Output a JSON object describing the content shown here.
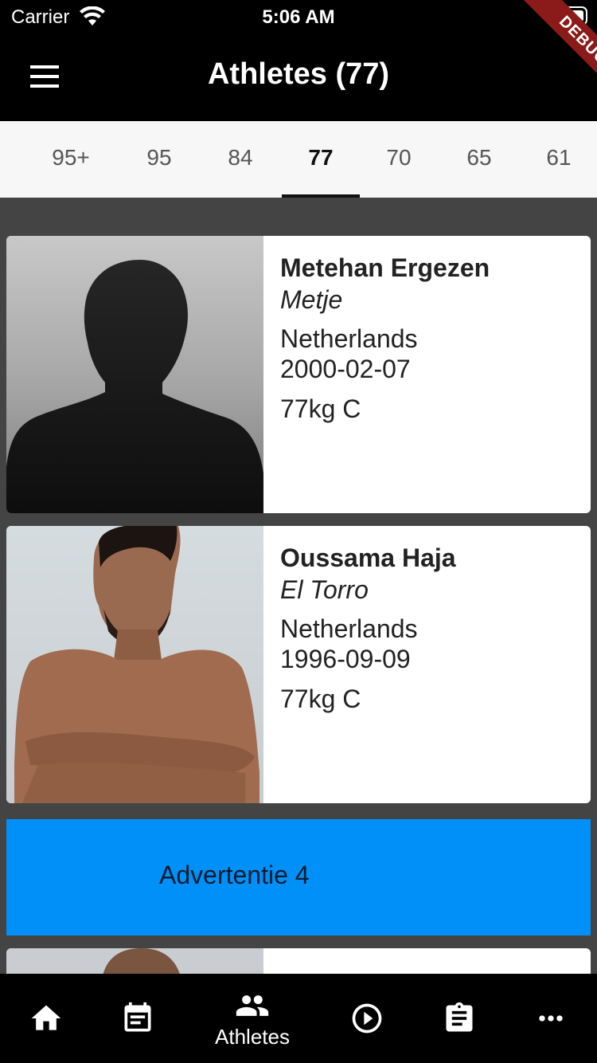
{
  "status_bar": {
    "carrier": "Carrier",
    "time": "5:06 AM"
  },
  "debug_banner": "DEBUG",
  "app_bar": {
    "title": "Athletes (77)"
  },
  "tabs": [
    {
      "label": "95+"
    },
    {
      "label": "95"
    },
    {
      "label": "84"
    },
    {
      "label": "77",
      "active": true
    },
    {
      "label": "70"
    },
    {
      "label": "65"
    },
    {
      "label": "61"
    }
  ],
  "athletes": [
    {
      "name": "Metehan Ergezen",
      "nickname": "Metje",
      "country": "Netherlands",
      "dob": "2000-02-07",
      "weight_class": "77kg  C"
    },
    {
      "name": "Oussama Haja",
      "nickname": "El Torro",
      "country": "Netherlands",
      "dob": "1996-09-09",
      "weight_class": "77kg  C"
    }
  ],
  "ad": {
    "label": "Advertentie 4",
    "color": "#0090f8"
  },
  "bottom_nav": {
    "items": [
      {
        "icon": "home-icon"
      },
      {
        "icon": "calendar-icon"
      },
      {
        "icon": "people-icon",
        "label": "Athletes",
        "active": true
      },
      {
        "icon": "play-circle-icon"
      },
      {
        "icon": "clipboard-icon"
      },
      {
        "icon": "more-horiz-icon"
      }
    ]
  }
}
